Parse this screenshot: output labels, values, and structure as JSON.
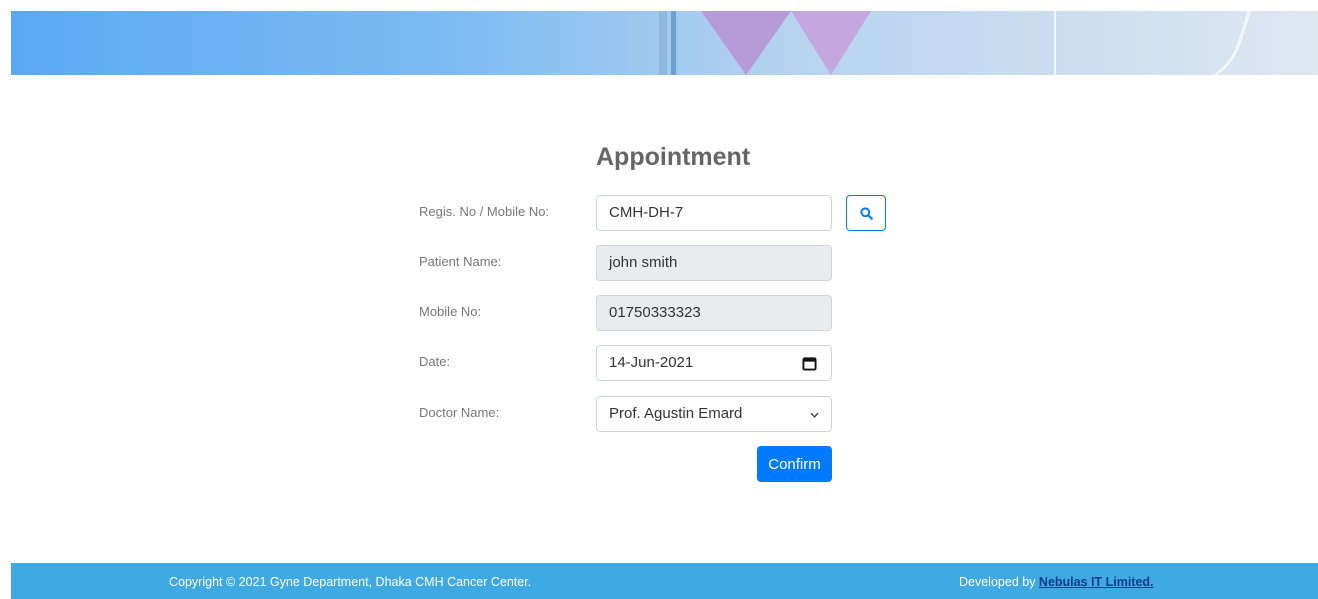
{
  "title": "Appointment",
  "form": {
    "regis": {
      "label": "Regis. No / Mobile No:",
      "value": "CMH-DH-7"
    },
    "patient": {
      "label": "Patient Name:",
      "value": "john smith"
    },
    "mobile": {
      "label": "Mobile No:",
      "value": "01750333323"
    },
    "date": {
      "label": "Date:",
      "value": "14-Jun-2021"
    },
    "doctor": {
      "label": "Doctor Name:",
      "value": "Prof. Agustin Emard"
    }
  },
  "confirm_label": "Confirm",
  "footer": {
    "copyright": "Copyright © 2021 Gyne Department, Dhaka CMH Cancer Center.",
    "developed_by": "Developed by ",
    "developer": "Nebulas IT Limited."
  },
  "colors": {
    "primary": "#007bff",
    "footer": "#3fa9e3",
    "readonly": "#e9ecef"
  },
  "icons": {
    "search": "search-icon",
    "calendar": "calendar-icon",
    "dropdown": "chevron-down-icon"
  }
}
